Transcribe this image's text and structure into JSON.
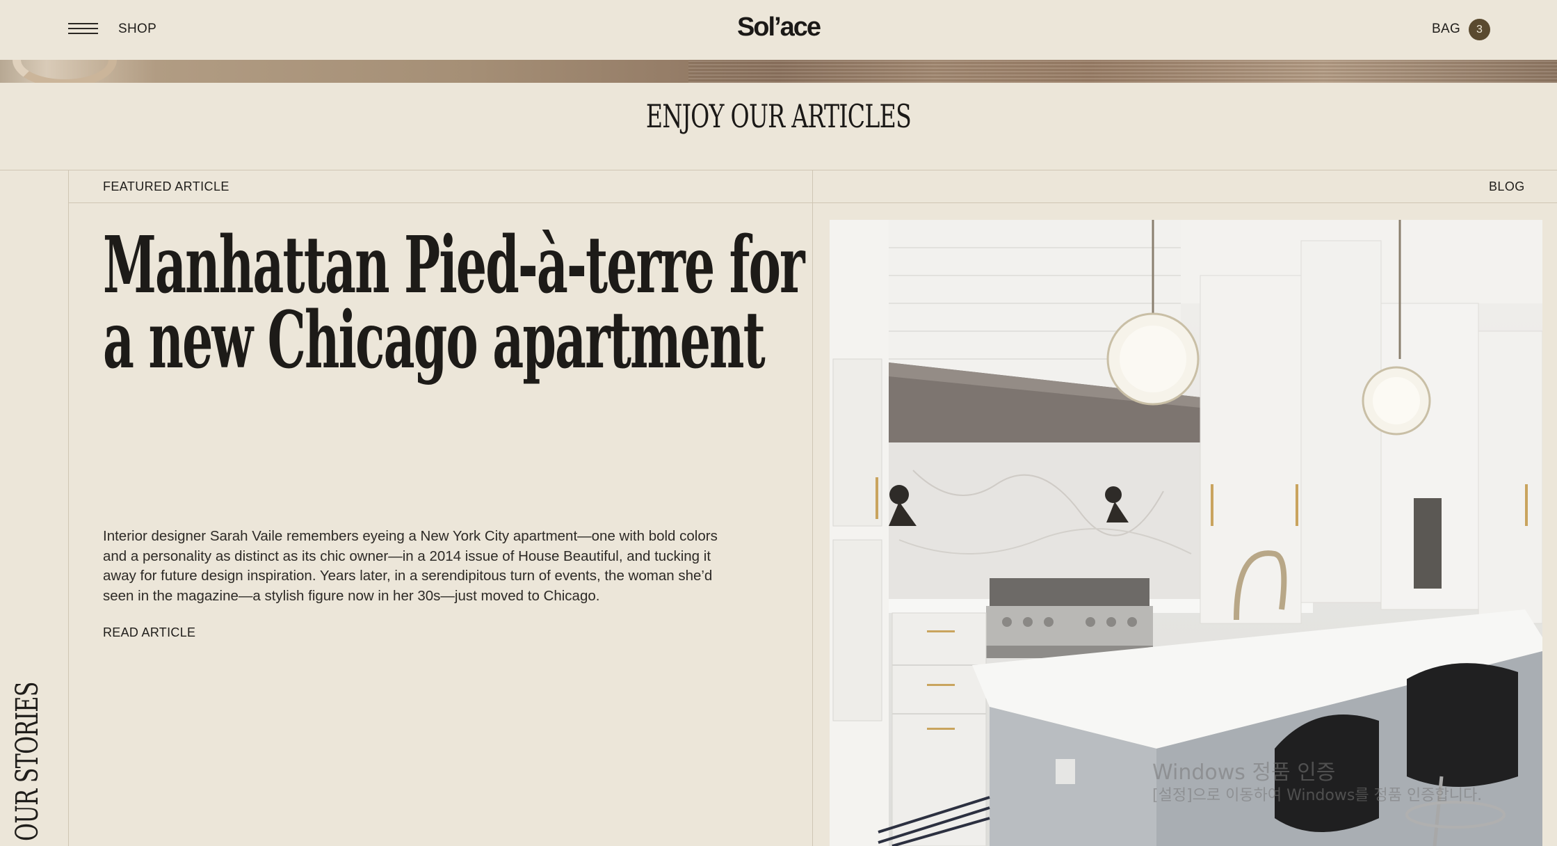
{
  "header": {
    "shop_label": "SHOP",
    "logo_text": "Sol’ace",
    "bag_label": "BAG",
    "bag_count": "3"
  },
  "section": {
    "title": "ENJOY OUR ARTICLES",
    "side_label": "OUR STORIES"
  },
  "featured": {
    "label": "FEATURED ARTICLE",
    "blog_label": "BLOG",
    "title_line1": "Manhattan Pied-à-terre for",
    "title_line2": "a new Chicago apartment",
    "body": "Interior designer Sarah Vaile remembers eyeing a New York City apartment—one with bold colors and a personality as distinct as its chic owner—in a 2014 issue of House Beautiful, and tucking it away for future design inspiration. Years later, in a serendipitous turn of events, the woman she’d seen in the magazine—a stylish figure now in her 30s—just moved to Chicago.",
    "read_label": "READ ARTICLE"
  },
  "watermark": {
    "title": "Windows 정품 인증",
    "subtitle": "[설정]으로 이동하여 Windows를 정품 인증합니다."
  },
  "colors": {
    "background": "#ece6d9",
    "text": "#1f1d1a",
    "badge": "#5a4a2f",
    "rule": "#cfc6b4"
  }
}
